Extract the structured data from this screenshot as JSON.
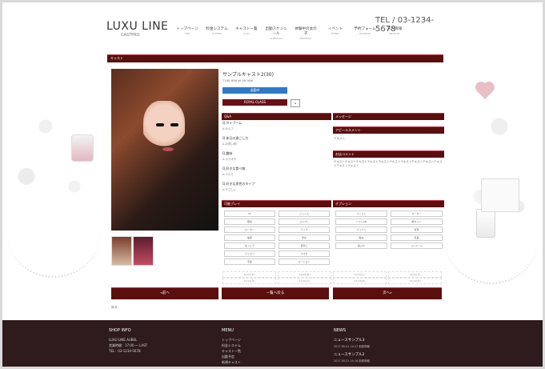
{
  "header": {
    "logo_main": "LUXU LINE",
    "logo_sub": "CASTPRO",
    "tel_top": "",
    "tel": "TEL / 03-1234-5678"
  },
  "nav": {
    "items": [
      {
        "label": "トップページ",
        "sub": "TOP"
      },
      {
        "label": "料金システム",
        "sub": "SYSTEM"
      },
      {
        "label": "キャスト一覧",
        "sub": "CAST"
      },
      {
        "label": "出勤スケジュール",
        "sub": "SCHEDULE"
      },
      {
        "label": "体験中の女の子",
        "sub": "NEWFACE"
      },
      {
        "label": "イベント",
        "sub": "EVENT"
      },
      {
        "label": "予約フォーム",
        "sub": "RESERVE"
      },
      {
        "label": "求人情報",
        "sub": "RECRUIT"
      }
    ]
  },
  "breadcrumb": "",
  "page_title": "キャスト",
  "profile": {
    "name": "サンプルキャスト2(30)",
    "sizes": "T168 B88 W 56 H86",
    "status": "出勤中",
    "class_label": "ROYAL CLASS",
    "class_icon": "≡"
  },
  "qa": {
    "title": "Q&A",
    "items": [
      {
        "q": "Q.タイプーム",
        "a": "A.セルフ"
      },
      {
        "q": "Q.休日の過ごし方",
        "a": "A.お買い物"
      },
      {
        "q": "Q.趣味",
        "a": "A.カラオケ"
      },
      {
        "q": "Q.好きな食べ物",
        "a": "A.クルミ"
      },
      {
        "q": "Q.好きな男性のタイプ",
        "a": "A.やさしい"
      }
    ]
  },
  "message": {
    "title": "メッセージ",
    "appeal_title": "アピールスメント",
    "appeal_text": "テキスト",
    "comment_title": "お店コメント",
    "comment_text": "テキストテキストテキストテキストテキストテキストテキストテキストテキストテキストテキストテキスト"
  },
  "play": {
    "title": "可能プレイ",
    "options": [
      "AF",
      "ごっくん",
      "顔射",
      "コスプレ",
      "ローター",
      "バイブ",
      "放尿",
      "聖水",
      "生フェラ",
      "目隠し",
      "パイズリ",
      "スマタ",
      "手錠",
      "ローション"
    ]
  },
  "option": {
    "title": "オプション",
    "options": [
      "パンスト",
      "ガーター",
      "ソフトSM",
      "網タイツ",
      "パイパン",
      "写真",
      "脱衣",
      "乳首",
      "指入れ",
      "コンドーム"
    ]
  },
  "schedule": {
    "items": [
      "12/07(木)",
      "12/08(金)",
      "12/09(土)",
      "12/10(日)",
      "12/11(月)",
      "12/12(火)",
      "12/13(水)",
      "12/14(木)"
    ]
  },
  "buttons": {
    "prev": "«前へ",
    "list": "一覧へ戻る",
    "next": "次へ»"
  },
  "back_link": "戻る",
  "footer": {
    "shop_title": "SHOP INFO",
    "shop_name": "LUXU LINE AUBEL",
    "shop_hours": "営業時間：17:00 ～ LAST",
    "shop_tel": "TEL：03-1234-5678",
    "menu_title": "MENU",
    "menu_items": [
      "トップページ",
      "料金システム",
      "キャスト一覧",
      "出勤予定",
      "新規キャスト"
    ],
    "news_title": "NEWS",
    "news": [
      {
        "title": "ニュースサンプル3",
        "meta": "2017.05.21 14:17 新着情報"
      },
      {
        "title": "ニュースサンプル2",
        "meta": "2017.05.21 14:16 新着情報"
      }
    ]
  },
  "colors": {
    "maroon": "#5a0e0e",
    "blue": "#2f79c7",
    "footer": "#2f1b1b"
  }
}
